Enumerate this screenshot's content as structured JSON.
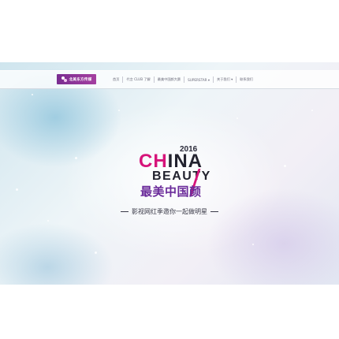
{
  "header": {
    "logo_text": "北美东方传媒"
  },
  "nav": {
    "items": [
      {
        "label": "首页"
      },
      {
        "label": "代言 CLUB 了解"
      },
      {
        "label": "最美中国颜大赛"
      },
      {
        "label": "SUPERSTAR ▾"
      },
      {
        "label": "关于我们 ▾"
      },
      {
        "label": "联系我们"
      }
    ]
  },
  "hero": {
    "year": "2016",
    "china_first": "CH",
    "china_rest": "INA",
    "beauty": "BEAUTY",
    "chinese_title": "最美中国颜",
    "tagline": "影视网红季邀你一起做明星"
  },
  "colors": {
    "brand_purple": "#7a2d91",
    "accent_pink": "#d6147a",
    "title_purple": "#6a2a9a"
  }
}
